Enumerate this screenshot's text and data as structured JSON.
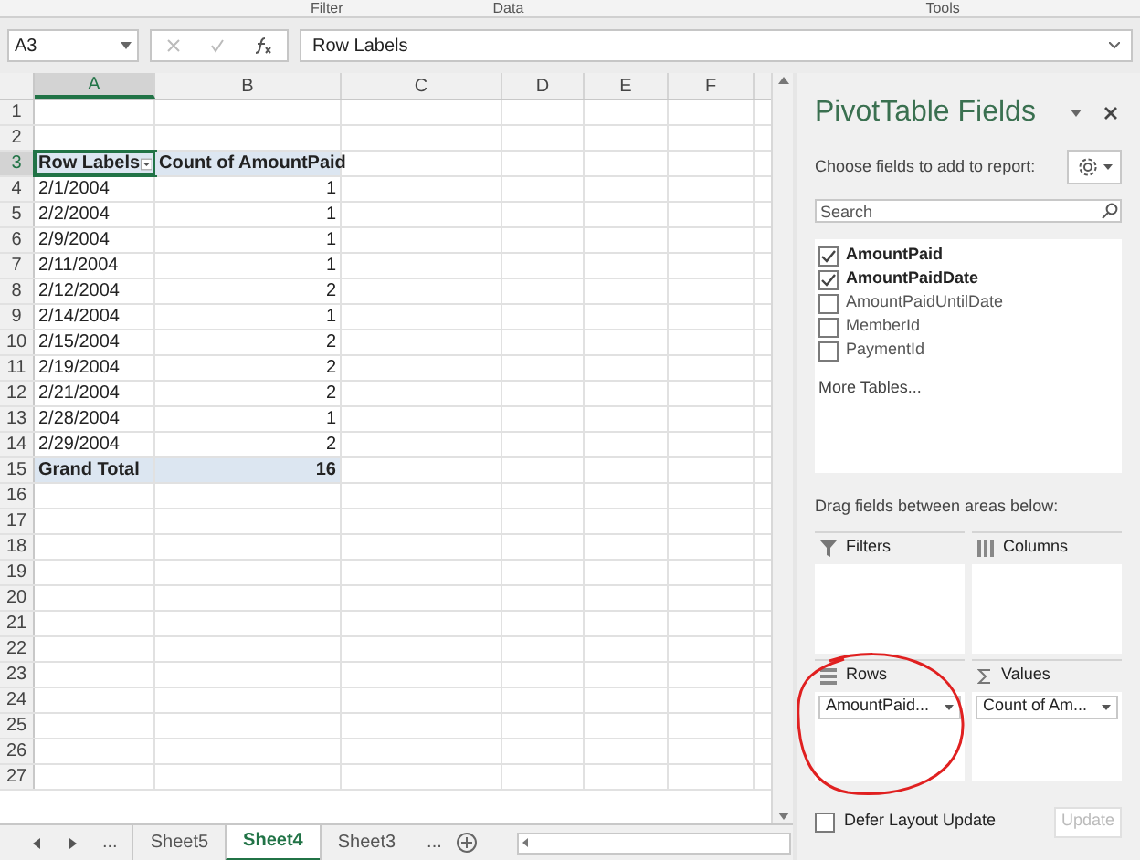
{
  "ribbon": {
    "groups": [
      "Filter",
      "Data",
      "Tools"
    ]
  },
  "formula_bar": {
    "name_box": "A3",
    "value": "Row Labels"
  },
  "sheet": {
    "columns": [
      {
        "label": "A",
        "selected": true
      },
      {
        "label": "B",
        "selected": false
      },
      {
        "label": "C",
        "selected": false
      },
      {
        "label": "D",
        "selected": false
      },
      {
        "label": "E",
        "selected": false
      },
      {
        "label": "F",
        "selected": false
      }
    ],
    "rows": [
      {
        "number": "1",
        "kind": "empty",
        "cells": []
      },
      {
        "number": "2",
        "kind": "empty",
        "cells": []
      },
      {
        "number": "3",
        "kind": "header",
        "selected": true,
        "cells": [
          "Row Labels",
          "Count of AmountPaid"
        ]
      },
      {
        "number": "4",
        "kind": "data",
        "cells": [
          "2/1/2004",
          "1"
        ]
      },
      {
        "number": "5",
        "kind": "data",
        "cells": [
          "2/2/2004",
          "1"
        ]
      },
      {
        "number": "6",
        "kind": "data",
        "cells": [
          "2/9/2004",
          "1"
        ]
      },
      {
        "number": "7",
        "kind": "data",
        "cells": [
          "2/11/2004",
          "1"
        ]
      },
      {
        "number": "8",
        "kind": "data",
        "cells": [
          "2/12/2004",
          "2"
        ]
      },
      {
        "number": "9",
        "kind": "data",
        "cells": [
          "2/14/2004",
          "1"
        ]
      },
      {
        "number": "10",
        "kind": "data",
        "cells": [
          "2/15/2004",
          "2"
        ]
      },
      {
        "number": "11",
        "kind": "data",
        "cells": [
          "2/19/2004",
          "2"
        ]
      },
      {
        "number": "12",
        "kind": "data",
        "cells": [
          "2/21/2004",
          "2"
        ]
      },
      {
        "number": "13",
        "kind": "data",
        "cells": [
          "2/28/2004",
          "1"
        ]
      },
      {
        "number": "14",
        "kind": "data",
        "cells": [
          "2/29/2004",
          "2"
        ]
      },
      {
        "number": "15",
        "kind": "total",
        "cells": [
          "Grand Total",
          "16"
        ]
      },
      {
        "number": "16",
        "kind": "empty",
        "cells": []
      },
      {
        "number": "17",
        "kind": "empty",
        "cells": []
      },
      {
        "number": "18",
        "kind": "empty",
        "cells": []
      },
      {
        "number": "19",
        "kind": "empty",
        "cells": []
      },
      {
        "number": "20",
        "kind": "empty",
        "cells": []
      },
      {
        "number": "21",
        "kind": "empty",
        "cells": []
      },
      {
        "number": "22",
        "kind": "empty",
        "cells": []
      },
      {
        "number": "23",
        "kind": "empty",
        "cells": []
      },
      {
        "number": "24",
        "kind": "empty",
        "cells": []
      },
      {
        "number": "25",
        "kind": "empty",
        "cells": []
      },
      {
        "number": "26",
        "kind": "empty",
        "cells": []
      },
      {
        "number": "27",
        "kind": "empty",
        "cells": []
      }
    ]
  },
  "sheet_tabs": {
    "overflow_left": "...",
    "overflow_right": "...",
    "tabs": [
      {
        "label": "Sheet5",
        "selected": false
      },
      {
        "label": "Sheet4",
        "selected": true
      },
      {
        "label": "Sheet3",
        "selected": false
      }
    ]
  },
  "panel": {
    "title": "PivotTable Fields",
    "subtitle": "Choose fields to add to report:",
    "search": {
      "placeholder": "Search"
    },
    "fields": [
      {
        "label": "AmountPaid",
        "checked": true
      },
      {
        "label": "AmountPaidDate",
        "checked": true
      },
      {
        "label": "AmountPaidUntilDate",
        "checked": false
      },
      {
        "label": "MemberId",
        "checked": false
      },
      {
        "label": "PaymentId",
        "checked": false
      }
    ],
    "more_tables": "More Tables...",
    "areas_hint": "Drag fields between areas below:",
    "areas": [
      {
        "kind": "filters",
        "label": "Filters"
      },
      {
        "kind": "columns",
        "label": "Columns"
      },
      {
        "kind": "rows",
        "label": "Rows",
        "items": [
          "AmountPaid..."
        ]
      },
      {
        "kind": "values",
        "label": "Values",
        "items": [
          "Count of Am..."
        ]
      }
    ],
    "defer_update": {
      "label": "Defer Layout Update",
      "checked": false
    },
    "update_button": {
      "label": "Update",
      "disabled": true
    }
  }
}
